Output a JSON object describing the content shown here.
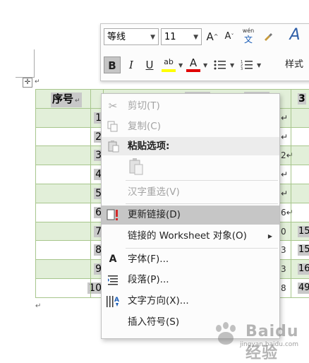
{
  "toolbar": {
    "font_name": "等线",
    "font_size": "11",
    "grow_font": "A",
    "shrink_font": "A",
    "phonetic_top": "wén",
    "phonetic_bottom": "文",
    "bold": "B",
    "italic": "I",
    "underline": "U",
    "highlight_glyph": "ab",
    "font_color_glyph": "A",
    "styles_glyph": "A",
    "styles_label": "样式"
  },
  "table": {
    "header_label": "序号",
    "header_right": "3",
    "para_mark": "↵",
    "row_numbers": [
      "1",
      "2",
      "3",
      "4",
      "5",
      "6",
      "7",
      "8",
      "9",
      "10"
    ],
    "right_values": [
      "",
      "",
      "",
      "",
      "",
      "",
      "15",
      "15",
      "16",
      "49"
    ],
    "mid_marks": [
      "↵",
      "↵",
      "2↵",
      "↵",
      "↵",
      "6↵",
      "0",
      "3",
      "3",
      "8"
    ]
  },
  "context_menu": {
    "items": [
      {
        "label": "剪切(T)",
        "state": "disabled",
        "icon": "scissors-icon"
      },
      {
        "label": "复制(C)",
        "state": "disabled",
        "icon": "copy-icon"
      },
      {
        "label": "粘贴选项:",
        "state": "section",
        "icon": "clipboard-icon"
      },
      {
        "label": "汉字重选(V)",
        "state": "disabled",
        "icon": ""
      },
      {
        "label": "更新链接(D)",
        "state": "highlighted",
        "icon": "update-link-icon"
      },
      {
        "label": "链接的 Worksheet 对象(O)",
        "state": "enabled",
        "icon": ""
      },
      {
        "label": "字体(F)...",
        "state": "enabled",
        "icon": "font-icon"
      },
      {
        "label": "段落(P)...",
        "state": "enabled",
        "icon": "paragraph-icon"
      },
      {
        "label": "文字方向(X)...",
        "state": "enabled",
        "icon": "text-direction-icon"
      },
      {
        "label": "插入符号(S)",
        "state": "enabled",
        "icon": ""
      }
    ]
  },
  "watermark": {
    "text": "Baidu 经验",
    "url": "jingyan.baidu.com"
  },
  "colors": {
    "row_green": "#e2efd9",
    "grid": "#a7c68c",
    "menu_highlight": "#c6c6c6",
    "update_link_red": "#d42a2a",
    "highlight_yellow": "#ffff00",
    "font_color_red": "#e00000"
  }
}
